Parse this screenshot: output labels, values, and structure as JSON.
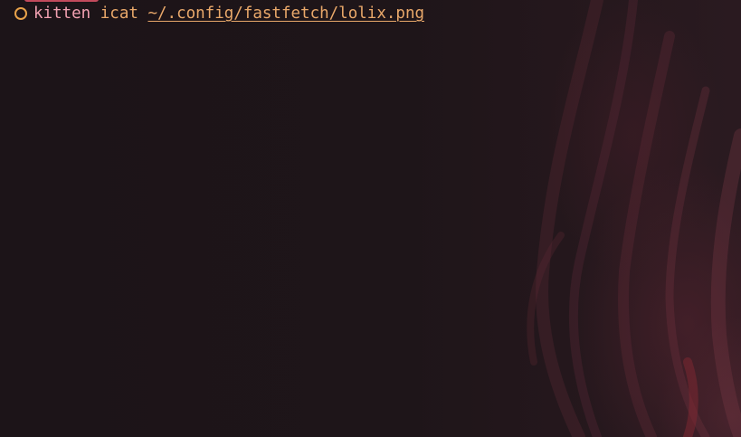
{
  "terminal": {
    "prompt_status_icon": "circle-status-icon",
    "command": "kitten",
    "argument": "icat",
    "path": "~/.config/fastfetch/lolix.png"
  },
  "colors": {
    "background": "#1b1417",
    "command": "#f0a0b0",
    "argument": "#e9a86a",
    "status_ring": "#e8a24a",
    "accent": "#c24a5c"
  }
}
